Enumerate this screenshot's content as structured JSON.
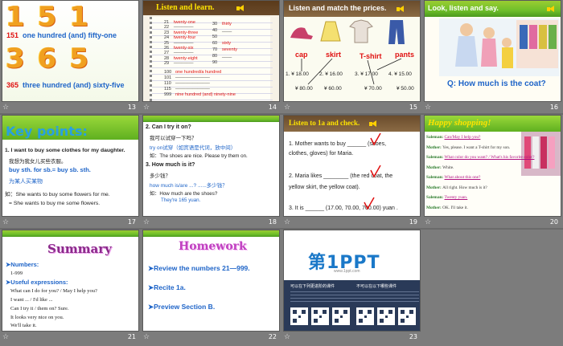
{
  "slides": [
    {
      "number": "13",
      "star": "☆",
      "line1_digits": "151",
      "line1_prefix": "151",
      "line1_text": "one hundred (and) fifty-one",
      "line2_digits": "365",
      "line2_prefix": "365",
      "line2_text": "three hundred (and) sixty-five"
    },
    {
      "number": "14",
      "star": "☆",
      "title": "Listen and learn.",
      "left_col": [
        "21",
        "22",
        "23",
        "24",
        "25",
        "26",
        "27",
        "28",
        "29"
      ],
      "left_words": [
        "twenty-one",
        "",
        "twenty-three",
        "twenty-four",
        "",
        "twenty-six",
        "",
        "twenty-eight",
        ""
      ],
      "right_col": [
        "30",
        "40",
        "50",
        "60",
        "70",
        "80",
        "90"
      ],
      "right_words": [
        "thirty",
        "____",
        "",
        "sixty",
        "seventy",
        "____",
        ""
      ],
      "bottom_nums": [
        "100",
        "101",
        "110",
        "115",
        "999"
      ],
      "bottom_words": [
        "one hundred/a hundred",
        "",
        "",
        "",
        "nine hundred (and) ninety-nine"
      ]
    },
    {
      "number": "15",
      "star": "☆",
      "title": "Listen and match the prices.",
      "labels": [
        "cap",
        "skirt",
        "T-shirt",
        "pants"
      ],
      "prices_row1": [
        "1. ¥ 18.00",
        "2. ¥ 16.00",
        "3. ¥ 17.00",
        "4. ¥ 15.00"
      ],
      "prices_row2": [
        "¥ 80.00",
        "¥ 60.00",
        "¥ 70.00",
        "¥ 50.00"
      ]
    },
    {
      "number": "16",
      "star": "☆",
      "title": "Look, listen and say.",
      "question": "Q:  How much is the coat?"
    },
    {
      "number": "17",
      "star": "☆",
      "title": "Key points:",
      "l1": "1. I want to buy some clothes for my daughter.",
      "l2": "我想为我女儿买些衣服。",
      "l3": "buy sth. for sb.= buy sb. sth.",
      "l4": "为某人买某物",
      "l5": "如：She wants to buy some flowers for me.",
      "l6": "= She wants to buy me some flowers."
    },
    {
      "number": "18",
      "star": "☆",
      "l1": "2. Can I try it on?",
      "l2": "我可以试穿一下吗？",
      "l3": "try on试穿（如宾语是代词，放中间）",
      "l4": "如：The shoes are nice. Please try them on.",
      "l5": "3. How much is it?",
      "l6": "多少钱？",
      "l7": "how much is/are ...? ......多少钱？",
      "l8": "如：How much are the shoes?",
      "l9": "They're 165 yuan."
    },
    {
      "number": "19",
      "star": "☆",
      "title": "Listen to 1a and check.",
      "q1a": "1. Mother wants to buy ______ (shoes,",
      "q1b": "clothes, gloves) for Maria.",
      "q2a": "2. Maria likes ________ (the red coat, the",
      "q2b": "yellow skirt, the yellow coat).",
      "q3": "3. It is ______ (17.00, 70.00, 700.00) yuan ."
    },
    {
      "number": "20",
      "star": "☆",
      "title": "Happy shopping!",
      "lines": [
        [
          "Saleman:",
          "Can/May I help you?"
        ],
        [
          "Mother:",
          "Yes, please. I want a T-shirt for my son."
        ],
        [
          "Saleman:",
          "What color do you want? / What's his favorite color?"
        ],
        [
          "Mother:",
          "White."
        ],
        [
          "Saleman:",
          "What about this one?"
        ],
        [
          "Mother:",
          "All right. How much is it?"
        ],
        [
          "Saleman:",
          "Twenty yuan."
        ],
        [
          "Mother:",
          "OK. I'll take it."
        ]
      ]
    },
    {
      "number": "21",
      "star": "☆",
      "title": "Summary",
      "h1": "➤Numbers:",
      "n1": "1-999",
      "h2": "➤Useful expressions:",
      "e1": "What can I do for you? / May I help you?",
      "e2": "I want ... / I'd like ...",
      "e3": "Can I try it / them on?      Sure.",
      "e4": "It looks very nice on you.",
      "e5": "We'll take it."
    },
    {
      "number": "22",
      "star": "☆",
      "title": "Homework",
      "items": [
        "➤Review the numbers 21—999.",
        "➤Recite 1a.",
        "➤Preview Section B."
      ]
    },
    {
      "number": "23",
      "star": "☆",
      "logo_text": "第1PPT",
      "logo_sub": "www.1ppt.com",
      "left_caption": "可以在下列更进阶的课件",
      "right_caption": "不可以在以下哪些课件"
    }
  ],
  "colors": {
    "accent_blue": "#1e64c8",
    "accent_red": "#e01010",
    "band_green": "#6fbf2a",
    "title_yellow": "#ffe400"
  }
}
